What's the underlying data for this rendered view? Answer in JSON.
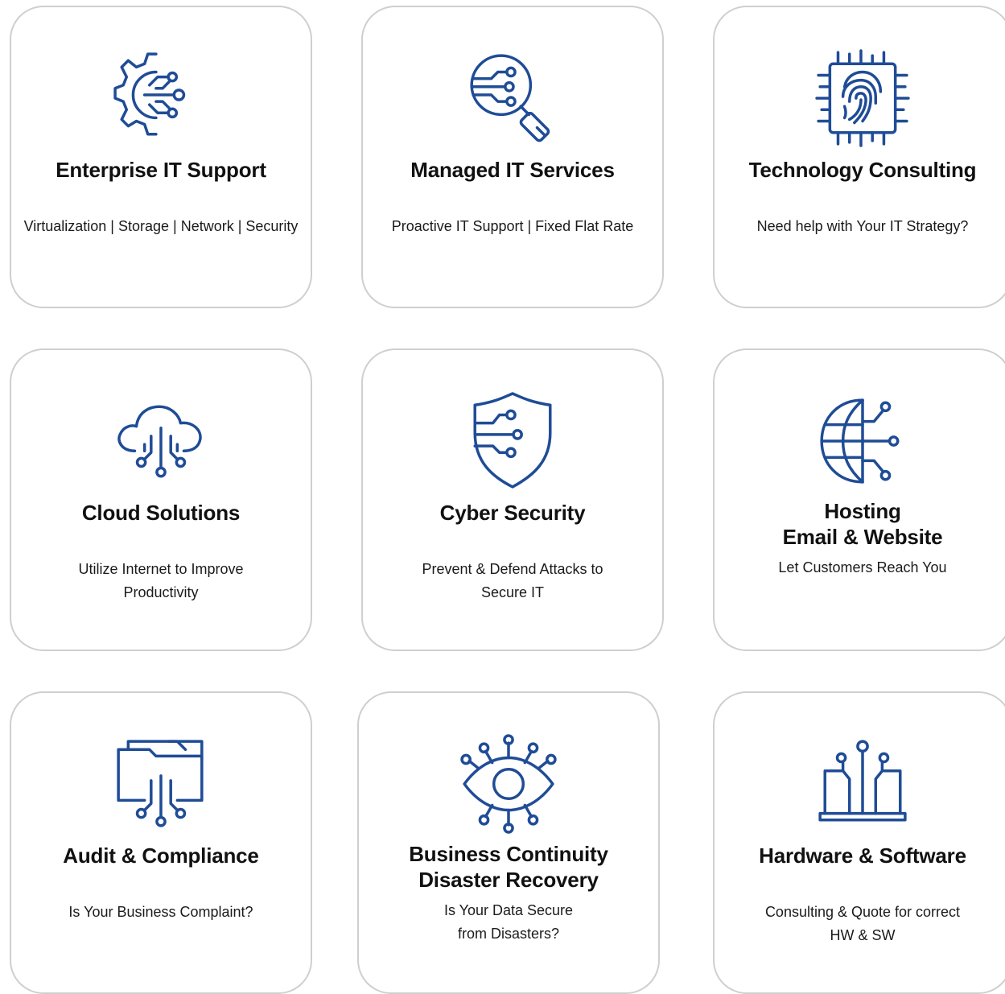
{
  "theme": {
    "icon_color": "#1f4c96",
    "border_color": "#cfcfcf",
    "text_color": "#111111"
  },
  "services": [
    {
      "icon": "gear-circuit-icon",
      "title": "Enterprise IT Support",
      "desc_lines": [
        "Virtualization | Storage | Network | Security"
      ]
    },
    {
      "icon": "magnifier-circuit-icon",
      "title": "Managed IT Services",
      "desc_lines": [
        "Proactive IT Support  | Fixed Flat Rate"
      ]
    },
    {
      "icon": "fingerprint-chip-icon",
      "title": "Technology Consulting",
      "desc_lines": [
        "Need help with Your IT Strategy?"
      ]
    },
    {
      "icon": "cloud-circuit-icon",
      "title": "Cloud Solutions",
      "desc_lines": [
        "Utilize Internet to Improve",
        "Productivity"
      ]
    },
    {
      "icon": "shield-circuit-icon",
      "title": "Cyber Security",
      "desc_lines": [
        "Prevent & Defend Attacks to",
        "Secure IT"
      ]
    },
    {
      "icon": "globe-circuit-icon",
      "title_lines": [
        "Hosting",
        "Email & Website"
      ],
      "desc_lines": [
        "Let Customers Reach You"
      ]
    },
    {
      "icon": "folder-circuit-icon",
      "title": "Audit & Compliance",
      "desc_lines": [
        "Is Your Business Complaint?"
      ]
    },
    {
      "icon": "eye-circuit-icon",
      "title_lines": [
        "Business Continuity",
        "Disaster Recovery"
      ],
      "desc_lines": [
        "Is Your Data Secure",
        "from Disasters?"
      ]
    },
    {
      "icon": "laptop-circuit-icon",
      "title": "Hardware & Software",
      "desc_lines": [
        "Consulting & Quote for correct",
        "HW & SW"
      ]
    }
  ]
}
